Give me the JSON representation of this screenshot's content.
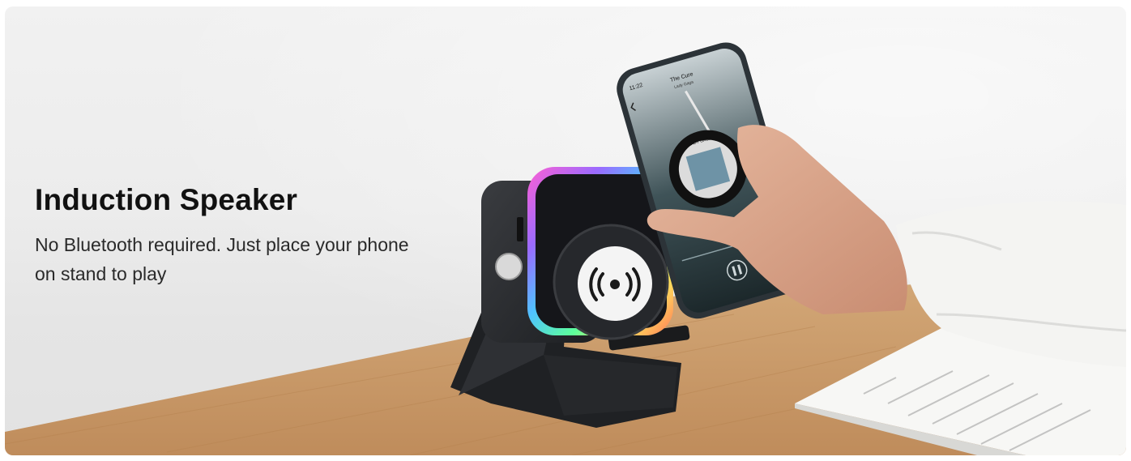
{
  "banner": {
    "title": "Induction Speaker",
    "description": "No Bluetooth required. Just place your phone on stand to play"
  },
  "phone_screen": {
    "time": "11:22",
    "track_title": "The Cure",
    "artist": "Lady Gaga",
    "album_label": "LADY GAGA"
  },
  "icons": {
    "wireless": "wireless-signal-icon",
    "back": "chevron-left-icon",
    "play_pause": "pause-icon"
  },
  "colors": {
    "speaker_body": "#2b2d30",
    "ring_gradient": [
      "#ff5fd2",
      "#9a6bff",
      "#4fc3ff",
      "#5dff9a",
      "#ffe45c",
      "#ff7a59"
    ],
    "desk_wood": "#c99b6c",
    "wall": "#ececec"
  }
}
